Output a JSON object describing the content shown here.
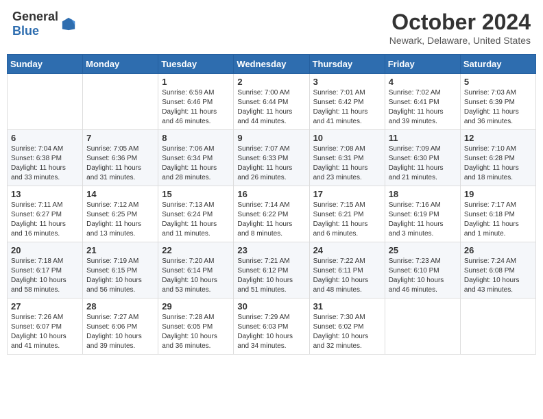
{
  "header": {
    "logo_general": "General",
    "logo_blue": "Blue",
    "month_title": "October 2024",
    "location": "Newark, Delaware, United States"
  },
  "days_of_week": [
    "Sunday",
    "Monday",
    "Tuesday",
    "Wednesday",
    "Thursday",
    "Friday",
    "Saturday"
  ],
  "weeks": [
    [
      {
        "day": "",
        "info": ""
      },
      {
        "day": "",
        "info": ""
      },
      {
        "day": "1",
        "info": "Sunrise: 6:59 AM\nSunset: 6:46 PM\nDaylight: 11 hours and 46 minutes."
      },
      {
        "day": "2",
        "info": "Sunrise: 7:00 AM\nSunset: 6:44 PM\nDaylight: 11 hours and 44 minutes."
      },
      {
        "day": "3",
        "info": "Sunrise: 7:01 AM\nSunset: 6:42 PM\nDaylight: 11 hours and 41 minutes."
      },
      {
        "day": "4",
        "info": "Sunrise: 7:02 AM\nSunset: 6:41 PM\nDaylight: 11 hours and 39 minutes."
      },
      {
        "day": "5",
        "info": "Sunrise: 7:03 AM\nSunset: 6:39 PM\nDaylight: 11 hours and 36 minutes."
      }
    ],
    [
      {
        "day": "6",
        "info": "Sunrise: 7:04 AM\nSunset: 6:38 PM\nDaylight: 11 hours and 33 minutes."
      },
      {
        "day": "7",
        "info": "Sunrise: 7:05 AM\nSunset: 6:36 PM\nDaylight: 11 hours and 31 minutes."
      },
      {
        "day": "8",
        "info": "Sunrise: 7:06 AM\nSunset: 6:34 PM\nDaylight: 11 hours and 28 minutes."
      },
      {
        "day": "9",
        "info": "Sunrise: 7:07 AM\nSunset: 6:33 PM\nDaylight: 11 hours and 26 minutes."
      },
      {
        "day": "10",
        "info": "Sunrise: 7:08 AM\nSunset: 6:31 PM\nDaylight: 11 hours and 23 minutes."
      },
      {
        "day": "11",
        "info": "Sunrise: 7:09 AM\nSunset: 6:30 PM\nDaylight: 11 hours and 21 minutes."
      },
      {
        "day": "12",
        "info": "Sunrise: 7:10 AM\nSunset: 6:28 PM\nDaylight: 11 hours and 18 minutes."
      }
    ],
    [
      {
        "day": "13",
        "info": "Sunrise: 7:11 AM\nSunset: 6:27 PM\nDaylight: 11 hours and 16 minutes."
      },
      {
        "day": "14",
        "info": "Sunrise: 7:12 AM\nSunset: 6:25 PM\nDaylight: 11 hours and 13 minutes."
      },
      {
        "day": "15",
        "info": "Sunrise: 7:13 AM\nSunset: 6:24 PM\nDaylight: 11 hours and 11 minutes."
      },
      {
        "day": "16",
        "info": "Sunrise: 7:14 AM\nSunset: 6:22 PM\nDaylight: 11 hours and 8 minutes."
      },
      {
        "day": "17",
        "info": "Sunrise: 7:15 AM\nSunset: 6:21 PM\nDaylight: 11 hours and 6 minutes."
      },
      {
        "day": "18",
        "info": "Sunrise: 7:16 AM\nSunset: 6:19 PM\nDaylight: 11 hours and 3 minutes."
      },
      {
        "day": "19",
        "info": "Sunrise: 7:17 AM\nSunset: 6:18 PM\nDaylight: 11 hours and 1 minute."
      }
    ],
    [
      {
        "day": "20",
        "info": "Sunrise: 7:18 AM\nSunset: 6:17 PM\nDaylight: 10 hours and 58 minutes."
      },
      {
        "day": "21",
        "info": "Sunrise: 7:19 AM\nSunset: 6:15 PM\nDaylight: 10 hours and 56 minutes."
      },
      {
        "day": "22",
        "info": "Sunrise: 7:20 AM\nSunset: 6:14 PM\nDaylight: 10 hours and 53 minutes."
      },
      {
        "day": "23",
        "info": "Sunrise: 7:21 AM\nSunset: 6:12 PM\nDaylight: 10 hours and 51 minutes."
      },
      {
        "day": "24",
        "info": "Sunrise: 7:22 AM\nSunset: 6:11 PM\nDaylight: 10 hours and 48 minutes."
      },
      {
        "day": "25",
        "info": "Sunrise: 7:23 AM\nSunset: 6:10 PM\nDaylight: 10 hours and 46 minutes."
      },
      {
        "day": "26",
        "info": "Sunrise: 7:24 AM\nSunset: 6:08 PM\nDaylight: 10 hours and 43 minutes."
      }
    ],
    [
      {
        "day": "27",
        "info": "Sunrise: 7:26 AM\nSunset: 6:07 PM\nDaylight: 10 hours and 41 minutes."
      },
      {
        "day": "28",
        "info": "Sunrise: 7:27 AM\nSunset: 6:06 PM\nDaylight: 10 hours and 39 minutes."
      },
      {
        "day": "29",
        "info": "Sunrise: 7:28 AM\nSunset: 6:05 PM\nDaylight: 10 hours and 36 minutes."
      },
      {
        "day": "30",
        "info": "Sunrise: 7:29 AM\nSunset: 6:03 PM\nDaylight: 10 hours and 34 minutes."
      },
      {
        "day": "31",
        "info": "Sunrise: 7:30 AM\nSunset: 6:02 PM\nDaylight: 10 hours and 32 minutes."
      },
      {
        "day": "",
        "info": ""
      },
      {
        "day": "",
        "info": ""
      }
    ]
  ]
}
